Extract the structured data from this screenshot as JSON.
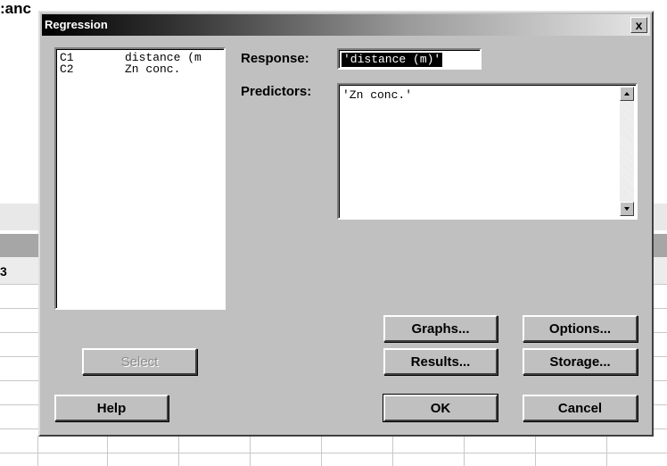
{
  "background": {
    "title_fragment": ":anc",
    "column_fragment": "3"
  },
  "dialog": {
    "title": "Regression",
    "close_label": "x",
    "variables": [
      {
        "id": "C1",
        "name": "distance (m"
      },
      {
        "id": "C2",
        "name": "Zn conc."
      }
    ],
    "response_label": "Response:",
    "response_value": "'distance (m)'",
    "predictors_label": "Predictors:",
    "predictors_value": "'Zn conc.'",
    "buttons": {
      "select": "Select",
      "graphs": "Graphs...",
      "options": "Options...",
      "results": "Results...",
      "storage": "Storage...",
      "help": "Help",
      "ok": "OK",
      "cancel": "Cancel"
    }
  }
}
